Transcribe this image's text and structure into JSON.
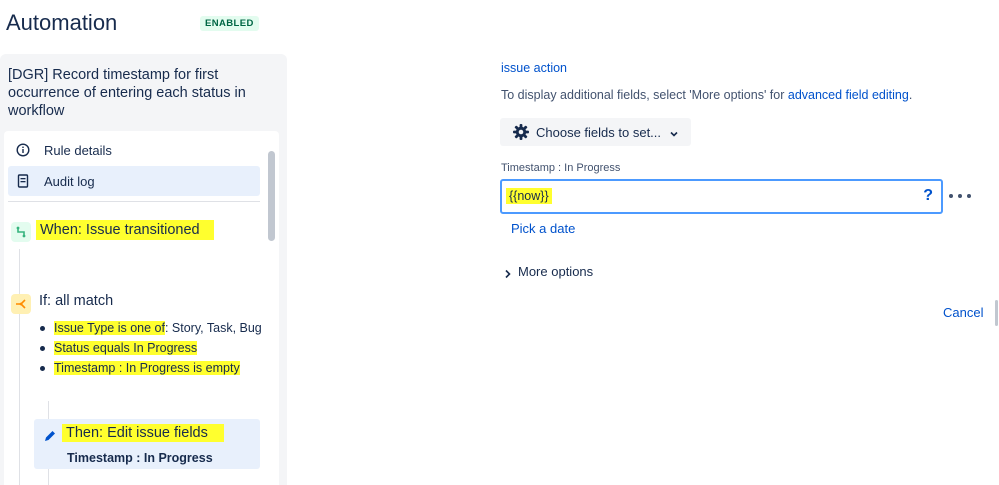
{
  "header": {
    "title": "Automation",
    "status_badge": "ENABLED"
  },
  "rule": {
    "title": "[DGR] Record timestamp for first occurrence of entering each status in workflow",
    "nav": {
      "rule_details": "Rule details",
      "audit_log": "Audit log"
    },
    "trigger": {
      "label": "When: Issue transitioned",
      "icon": "branch-icon"
    },
    "condition": {
      "label": "If: all match",
      "icon": "condition-icon",
      "items": [
        {
          "highlight": "Issue Type is one of",
          "rest": ": Story, Task, Bug"
        },
        {
          "highlight": "Status equals In Progress",
          "rest": ""
        },
        {
          "highlight": "Timestamp : In Progress is empty",
          "rest": ""
        }
      ]
    },
    "action": {
      "title": "Then: Edit issue fields",
      "subtitle": "Timestamp : In Progress",
      "icon": "pencil-icon"
    }
  },
  "editor": {
    "issue_action_link": "issue action",
    "hint_prefix": "To display additional fields, select 'More options' for ",
    "hint_link": "advanced field editing",
    "hint_suffix": ".",
    "choose_fields_label": "Choose fields to set...",
    "field_label": "Timestamp : In Progress",
    "field_value": "{{now}}",
    "help_symbol": "?",
    "pick_date": "Pick a date",
    "more_options": "More options",
    "cancel": "Cancel"
  },
  "colors": {
    "highlight": "#ffff2e",
    "link": "#0052cc",
    "focus_border": "#4c9aff",
    "badge_bg": "#e3fcef",
    "badge_text": "#006644"
  }
}
